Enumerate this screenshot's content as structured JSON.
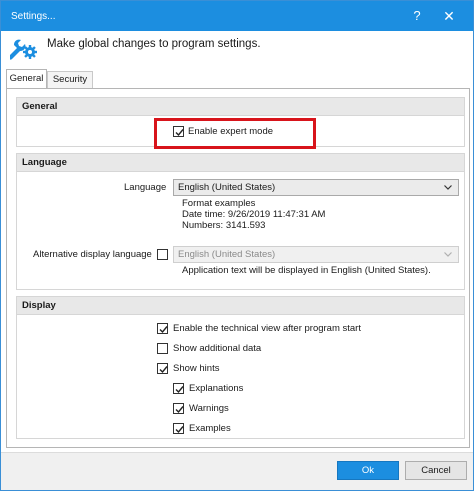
{
  "window": {
    "title": "Settings...",
    "help_glyph": "?",
    "close_glyph": "✕",
    "accent_color": "#1c8ee0"
  },
  "header": {
    "icon": "settings-wrench-gear-icon",
    "text": "Make global changes to program settings."
  },
  "tabs": [
    {
      "label": "General",
      "selected": true
    },
    {
      "label": "Security",
      "selected": false
    }
  ],
  "general": {
    "header": "General",
    "expert_mode": {
      "label": "Enable expert mode",
      "checked": true
    },
    "highlight_color": "#d8141b"
  },
  "language": {
    "header": "Language",
    "language_label": "Language",
    "language_value": "English (United States)",
    "format_title": "Format examples",
    "date_time": "Date time: 9/26/2019 11:47:31 AM",
    "numbers": "Numbers: 3141.593",
    "alt_label": "Alternative display language",
    "alt_checked": false,
    "alt_value": "English (United States)",
    "alt_note": "Application text will be displayed in English (United States)."
  },
  "display": {
    "header": "Display",
    "options": [
      {
        "label": "Enable the technical view after program start",
        "checked": true
      },
      {
        "label": "Show additional data",
        "checked": false
      },
      {
        "label": "Show hints",
        "checked": true
      },
      {
        "label": "Explanations",
        "checked": true
      },
      {
        "label": "Warnings",
        "checked": true
      },
      {
        "label": "Examples",
        "checked": true
      }
    ]
  },
  "footer": {
    "ok_label": "Ok",
    "cancel_label": "Cancel"
  }
}
